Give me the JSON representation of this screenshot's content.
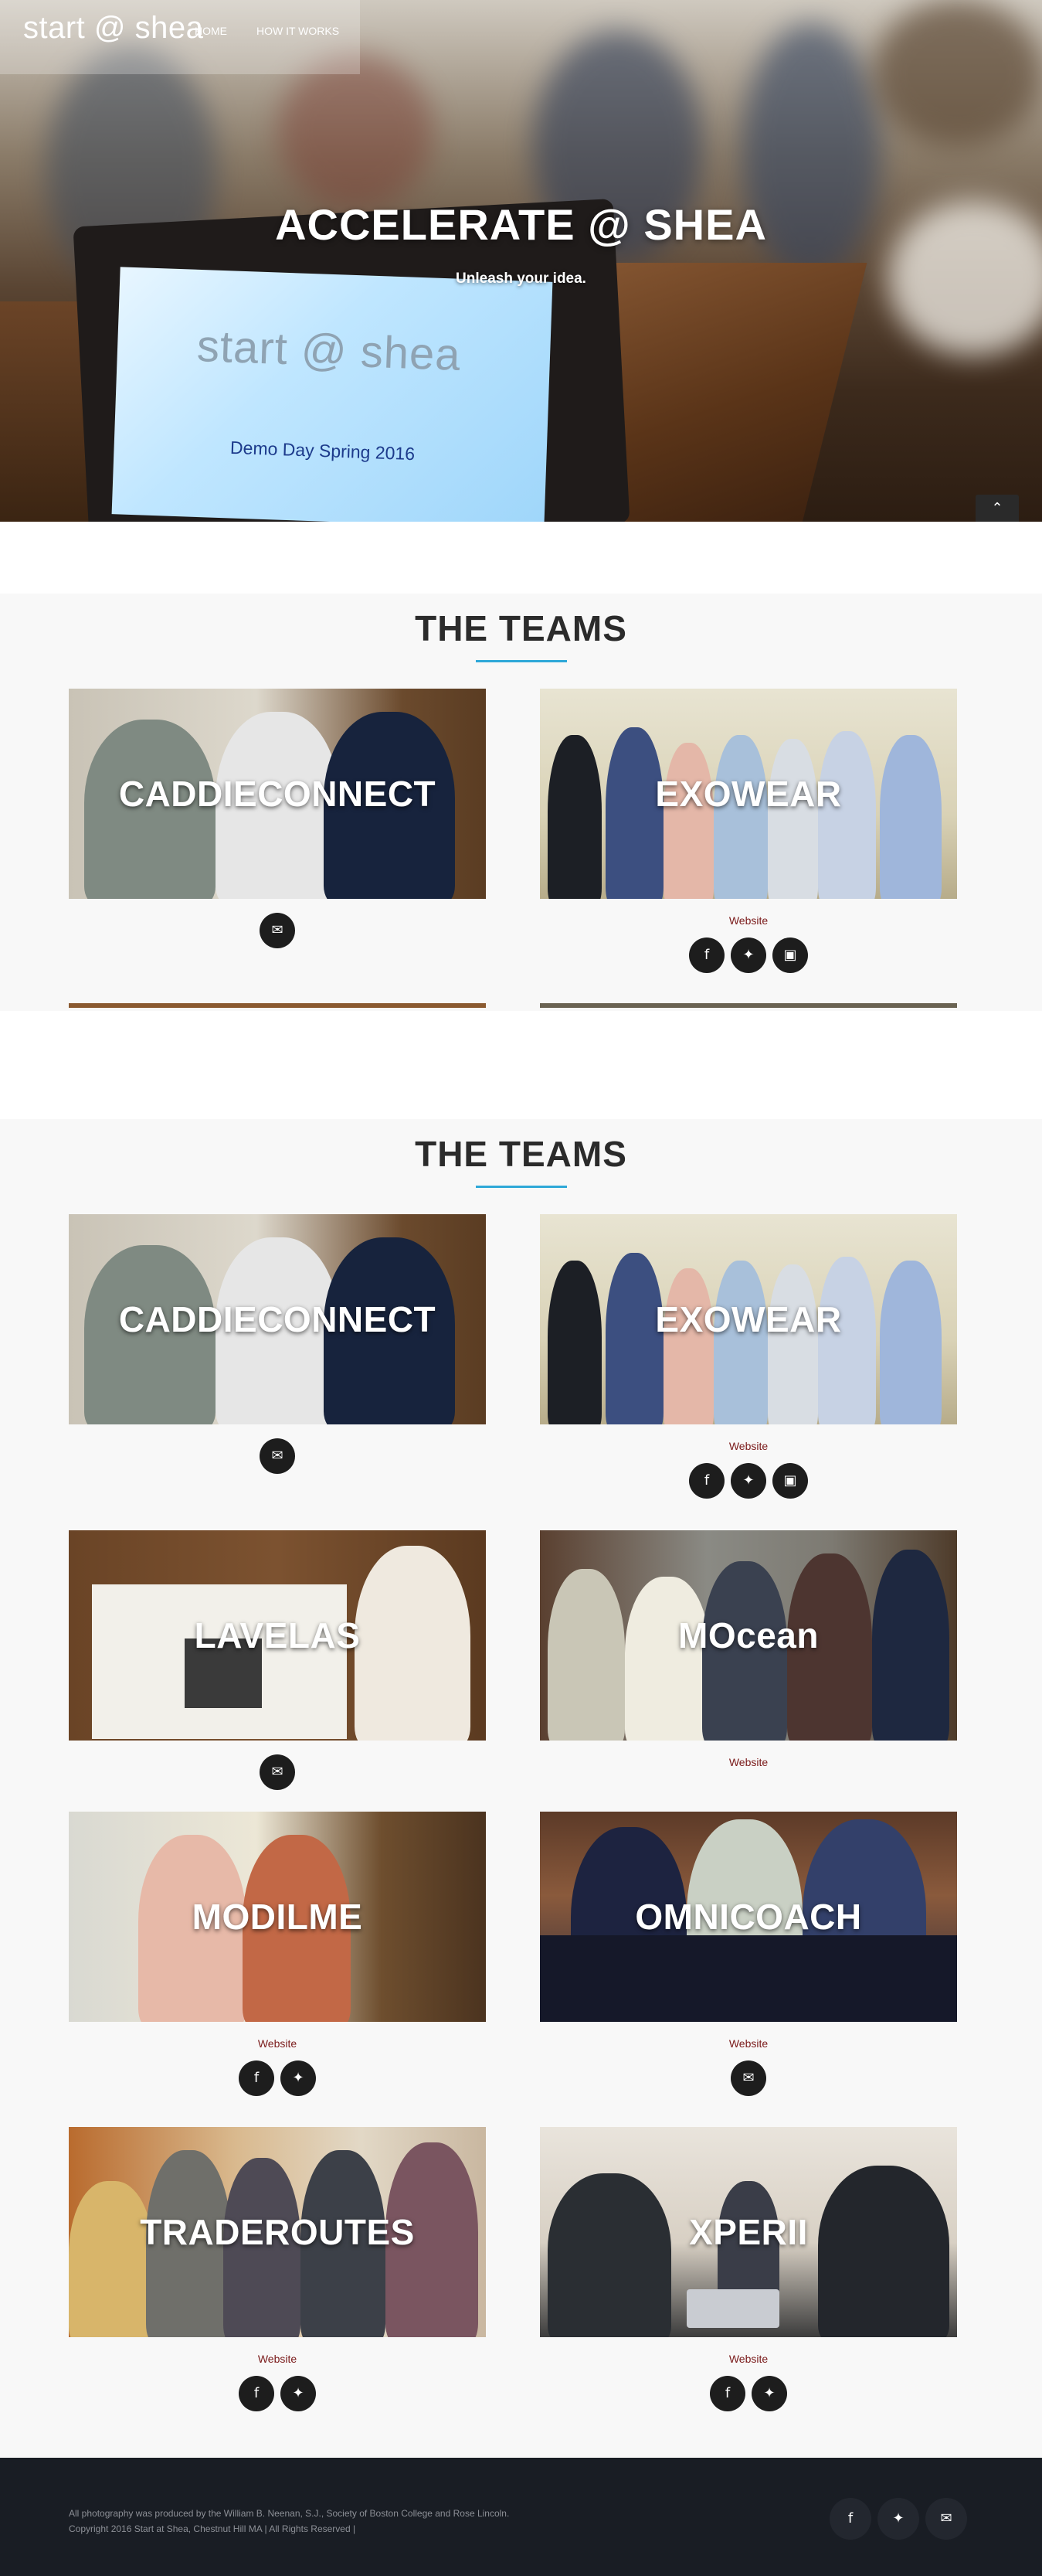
{
  "site": {
    "logo_text": "start @ shea",
    "nav": [
      {
        "label": "HOME"
      },
      {
        "label": "HOW IT WORKS"
      }
    ],
    "scroll_top_icon": "chevron-up-icon"
  },
  "hero": {
    "title": "ACCELERATE @ SHEA",
    "subtitle": "Unleash your idea.",
    "screen_logo": "start @ shea",
    "screen_caption": "Demo Day Spring 2016"
  },
  "teams_section_1": {
    "title": "THE TEAMS",
    "cards": [
      {
        "name": "CADDIECONNECT",
        "website": null,
        "icons": [
          "mail-icon"
        ]
      },
      {
        "name": "EXOWEAR",
        "website": "Website",
        "icons": [
          "facebook-icon",
          "twitter-icon",
          "instagram-icon"
        ]
      }
    ]
  },
  "teams_section_2": {
    "title": "THE TEAMS",
    "cards": [
      {
        "name": "CADDIECONNECT",
        "website": null,
        "icons": [
          "mail-icon"
        ]
      },
      {
        "name": "EXOWEAR",
        "website": "Website",
        "icons": [
          "facebook-icon",
          "twitter-icon",
          "instagram-icon"
        ]
      },
      {
        "name": "LAVELAS",
        "website": null,
        "icons": [
          "mail-icon"
        ]
      },
      {
        "name": "MOcean",
        "website": "Website",
        "icons": []
      },
      {
        "name": "MODILME",
        "website": "Website",
        "icons": [
          "facebook-icon",
          "twitter-icon"
        ]
      },
      {
        "name": "OMNICOACH",
        "website": "Website",
        "icons": [
          "mail-icon"
        ]
      },
      {
        "name": "TRADEROUTES",
        "website": "Website",
        "icons": [
          "facebook-icon",
          "twitter-icon"
        ]
      },
      {
        "name": "XPERII",
        "website": "Website",
        "icons": [
          "facebook-icon",
          "twitter-icon"
        ]
      }
    ]
  },
  "footer": {
    "credit": "All photography was produced by the William B. Neenan, S.J., Society of Boston College and Rose Lincoln.",
    "copyright": "Copyright 2016 Start at Shea, Chestnut Hill MA | All Rights Reserved |",
    "icons": [
      "facebook-icon",
      "twitter-icon",
      "mail-icon"
    ]
  },
  "colors": {
    "accent": "#2ea8d8",
    "link": "#7a1a1a",
    "footer_bg": "#191d24",
    "section_bg": "#f8f8f8"
  }
}
